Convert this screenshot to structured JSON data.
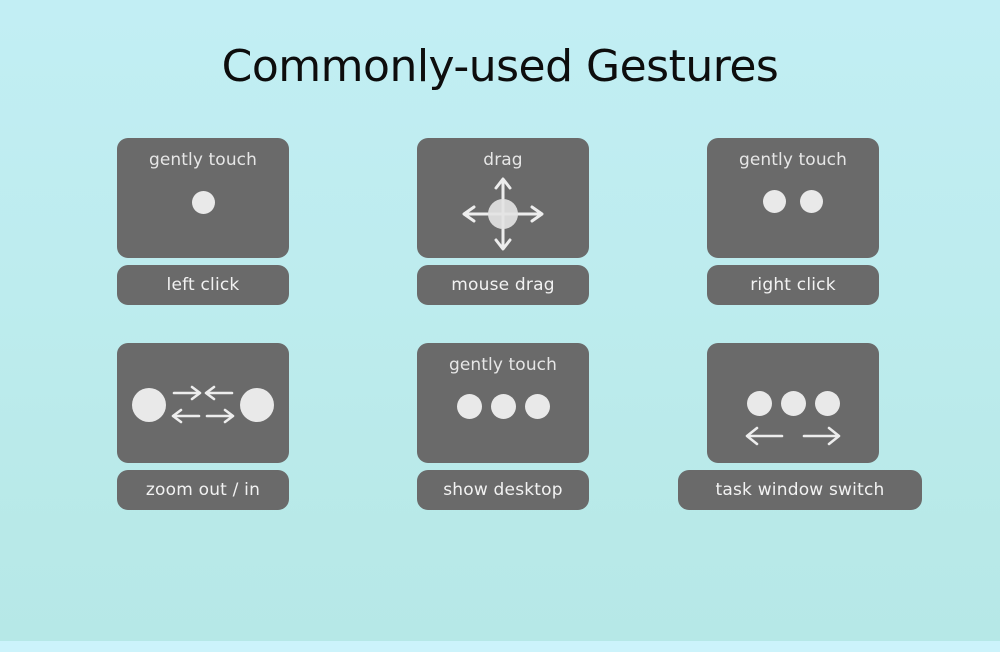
{
  "page": {
    "title": "Commonly-used Gestures",
    "background_top_color": "#c2eef4",
    "background_bottom_color": "#b6e8e7",
    "bottom_band_color": "#ccf3fb",
    "card_color": "#6a6a6a",
    "dot_color": "#e9e9e9",
    "text_color": "#e6e6e6",
    "title_color": "#0d0d0d"
  },
  "gestures": [
    {
      "id": "left-click",
      "hint": "gently touch",
      "label": "left click",
      "finger_count": 1,
      "glyph": "one-dot"
    },
    {
      "id": "mouse-drag",
      "hint": "drag",
      "label": "mouse drag",
      "finger_count": 1,
      "glyph": "dot-with-four-arrows"
    },
    {
      "id": "right-click",
      "hint": "gently touch",
      "label": "right click",
      "finger_count": 2,
      "glyph": "two-dots"
    },
    {
      "id": "zoom-out-in",
      "hint": "",
      "label": "zoom out / in",
      "finger_count": 2,
      "glyph": "two-dots-pinch-arrows"
    },
    {
      "id": "show-desktop",
      "hint": "gently touch",
      "label": "show desktop",
      "finger_count": 3,
      "glyph": "three-dots"
    },
    {
      "id": "task-window-switch",
      "hint": "",
      "label": "task window switch",
      "finger_count": 3,
      "glyph": "three-dots-left-right-arrows"
    }
  ]
}
